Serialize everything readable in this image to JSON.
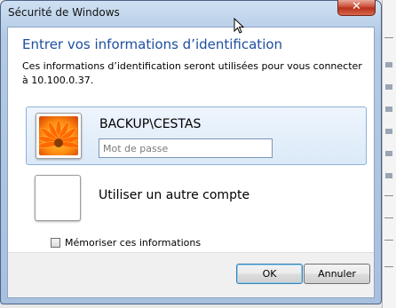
{
  "window": {
    "title": "Sécurité de Windows",
    "close_glyph": "✕"
  },
  "dialog": {
    "heading": "Entrer vos informations d’identification",
    "description": "Ces informations d’identification seront utilisées pour vous connecter à 10.100.0.37."
  },
  "accounts": {
    "current": {
      "name": "BACKUP\\CESTAS",
      "avatar_icon": "orange-flower-icon",
      "password": {
        "value": "",
        "placeholder": "Mot de passe"
      }
    },
    "other": {
      "label": "Utiliser un autre compte",
      "avatar_icon": "blank-avatar-icon"
    }
  },
  "remember": {
    "label": "Mémoriser ces informations",
    "checked": false
  },
  "buttons": {
    "ok": "OK",
    "cancel": "Annuler"
  },
  "colors": {
    "heading": "#1e4fa0",
    "selection_border": "#8fb2d8",
    "close_button": "#c7452d"
  }
}
